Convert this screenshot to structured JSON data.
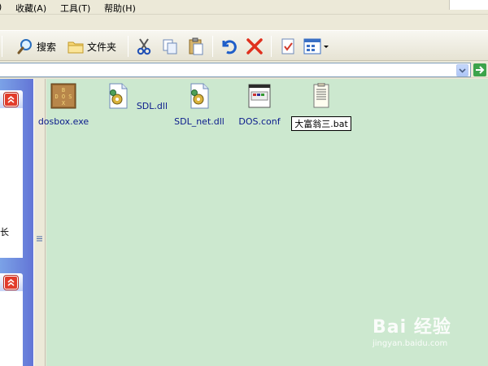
{
  "menu": {
    "items": [
      {
        "label": ")"
      },
      {
        "label": "收藏(A)"
      },
      {
        "label": "工具(T)"
      },
      {
        "label": "帮助(H)"
      }
    ]
  },
  "toolbar": {
    "search_label": "搜索",
    "folders_label": "文件夹"
  },
  "taskpane": {
    "fragment_text": "长"
  },
  "files": [
    {
      "name": "dosbox.exe",
      "icon": "dosbox-icon"
    },
    {
      "name": "SDL.dll",
      "icon": "dll-icon"
    },
    {
      "name": "SDL_net.dll",
      "icon": "dll-icon"
    },
    {
      "name": "DOS.conf",
      "icon": "conf-icon"
    },
    {
      "name": "大富翁三.bat",
      "icon": "bat-icon",
      "selected": true
    }
  ],
  "watermark": {
    "main": "Bai 经验",
    "sub": "jingyan.baidu.com"
  }
}
